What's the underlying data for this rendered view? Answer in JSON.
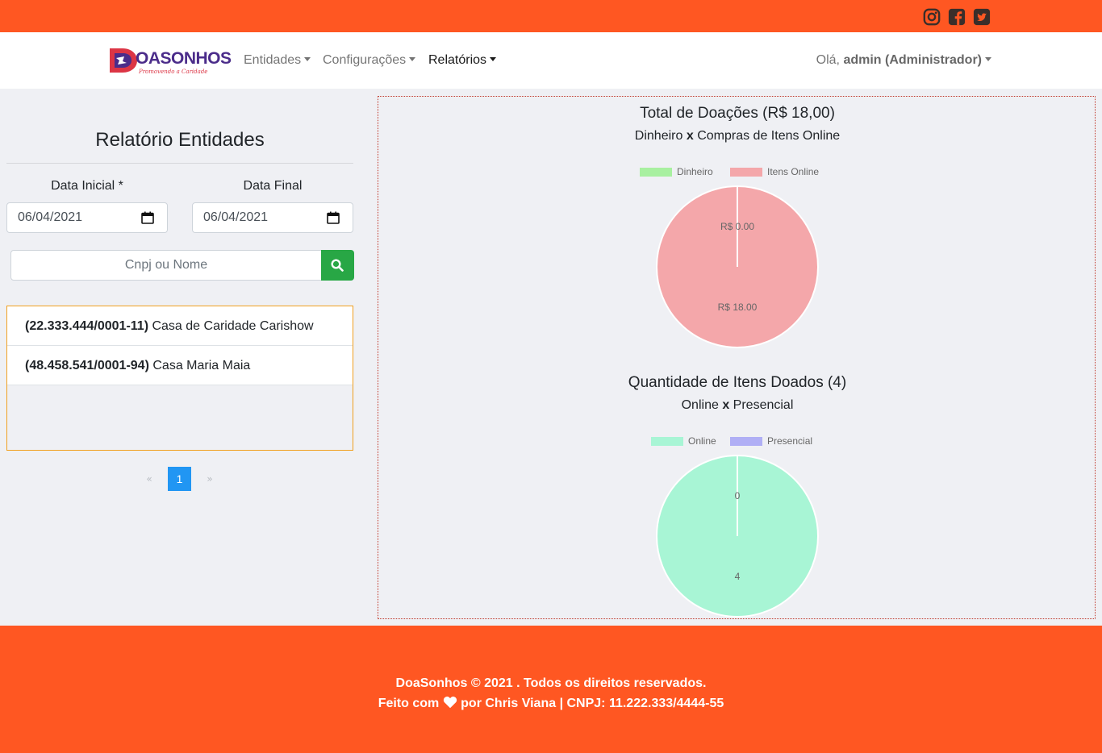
{
  "social": {
    "icons": [
      "instagram-icon",
      "facebook-icon",
      "twitter-icon"
    ]
  },
  "brand": {
    "logo_text_initial": "D",
    "logo_text_rest": "OASONHOS",
    "logo_tagline": "Promovendo a Caridade"
  },
  "nav": {
    "items": [
      {
        "label": "Entidades",
        "active": false
      },
      {
        "label": "Configurações",
        "active": false
      },
      {
        "label": "Relatórios",
        "active": true
      }
    ],
    "user_greeting": "Olá,",
    "user_name": "admin (Administrador)"
  },
  "sidebar": {
    "title": "Relatório Entidades",
    "start_date_label": "Data Inicial *",
    "start_date_value": "06/04/2021",
    "end_date_label": "Data Final",
    "end_date_value": "06/04/2021",
    "search_placeholder": "Cnpj ou Nome",
    "entities": [
      {
        "cnpj": "(22.333.444/0001-11)",
        "name": "Casa de Caridade Carishow"
      },
      {
        "cnpj": "(48.458.541/0001-94)",
        "name": "Casa Maria Maia"
      }
    ],
    "pagination": {
      "prev": "«",
      "current": "1",
      "next": "»"
    }
  },
  "chart_data": [
    {
      "type": "pie",
      "title": "Total de Doações (R$ 18,00)",
      "subtitle_left": "Dinheiro",
      "subtitle_mid": "x",
      "subtitle_right": "Compras de Itens Online",
      "categories": [
        "Dinheiro",
        "Itens Online"
      ],
      "values": [
        0,
        18
      ],
      "data_labels": [
        "R$ 0.00",
        "R$ 18.00"
      ],
      "colors": [
        "#a8f0a0",
        "#f4a7aa"
      ],
      "legend": "top"
    },
    {
      "type": "pie",
      "title": "Quantidade de Itens Doados (4)",
      "subtitle_left": "Online",
      "subtitle_mid": "x",
      "subtitle_right": "Presencial",
      "categories": [
        "Online",
        "Presencial"
      ],
      "values": [
        4,
        0
      ],
      "data_labels": [
        "4",
        "0"
      ],
      "colors": [
        "#a8f5d5",
        "#b0aff5"
      ],
      "legend": "top"
    }
  ],
  "footer": {
    "line1": "DoaSonhos © 2021 . Todos os direitos reservados.",
    "line2_pre": "Feito com",
    "line2_post": "por Chris Viana | CNPJ: 11.222.333/4444-55"
  }
}
